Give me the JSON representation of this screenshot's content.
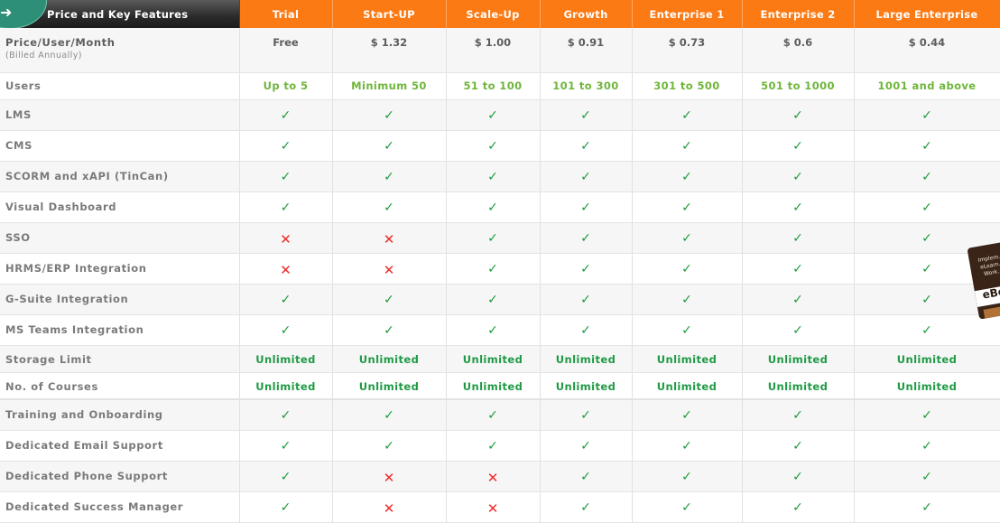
{
  "header": {
    "feature_column": "Price and Key Features",
    "plans": [
      "Trial",
      "Start-UP",
      "Scale-Up",
      "Growth",
      "Enterprise 1",
      "Enterprise 2",
      "Large Enterprise"
    ]
  },
  "price_row": {
    "label": "Price/User/Month",
    "sublabel": "(Billed Annually)",
    "values": [
      "Free",
      "$ 1.32",
      "$ 1.00",
      "$ 0.91",
      "$ 0.73",
      "$ 0.6",
      "$ 0.44"
    ]
  },
  "users_row": {
    "label": "Users",
    "values": [
      "Up to 5",
      "Minimum 50",
      "51 to 100",
      "101 to 300",
      "301 to 500",
      "501 to 1000",
      "1001 and above"
    ]
  },
  "symbols": {
    "check": "✓",
    "cross": "✕"
  },
  "features_a": [
    {
      "label": "LMS",
      "values": [
        true,
        true,
        true,
        true,
        true,
        true,
        true
      ]
    },
    {
      "label": "CMS",
      "values": [
        true,
        true,
        true,
        true,
        true,
        true,
        true
      ]
    },
    {
      "label": "SCORM and xAPI (TinCan)",
      "values": [
        true,
        true,
        true,
        true,
        true,
        true,
        true
      ]
    },
    {
      "label": "Visual Dashboard",
      "values": [
        true,
        true,
        true,
        true,
        true,
        true,
        true
      ]
    },
    {
      "label": "SSO",
      "values": [
        false,
        false,
        true,
        true,
        true,
        true,
        true
      ]
    },
    {
      "label": "HRMS/ERP Integration",
      "values": [
        false,
        false,
        true,
        true,
        true,
        true,
        true
      ]
    },
    {
      "label": "G-Suite Integration",
      "values": [
        true,
        true,
        true,
        true,
        true,
        true,
        true
      ]
    },
    {
      "label": "MS Teams Integration",
      "values": [
        true,
        true,
        true,
        true,
        true,
        true,
        true
      ]
    }
  ],
  "limits": [
    {
      "label": "Storage Limit",
      "values": [
        "Unlimited",
        "Unlimited",
        "Unlimited",
        "Unlimited",
        "Unlimited",
        "Unlimited",
        "Unlimited"
      ]
    },
    {
      "label": "No. of Courses",
      "values": [
        "Unlimited",
        "Unlimited",
        "Unlimited",
        "Unlimited",
        "Unlimited",
        "Unlimited",
        "Unlimited"
      ]
    }
  ],
  "features_b": [
    {
      "label": "Training and Onboarding",
      "values": [
        true,
        true,
        true,
        true,
        true,
        true,
        true
      ]
    },
    {
      "label": "Dedicated Email Support",
      "values": [
        true,
        true,
        true,
        true,
        true,
        true,
        true
      ]
    },
    {
      "label": "Dedicated Phone Support",
      "values": [
        true,
        false,
        false,
        true,
        true,
        true,
        true
      ]
    },
    {
      "label": "Dedicated Success Manager",
      "values": [
        true,
        false,
        false,
        true,
        true,
        true,
        true
      ]
    }
  ],
  "ebook_badge": {
    "text": "Implem... eLearn... Work...",
    "brand": "eBo"
  },
  "colors": {
    "accent": "#fc7a14",
    "check": "#1e9b3f",
    "cross": "#ee2b2b",
    "users_green": "#6fb53a",
    "unlimited_green": "#1f9a45"
  }
}
